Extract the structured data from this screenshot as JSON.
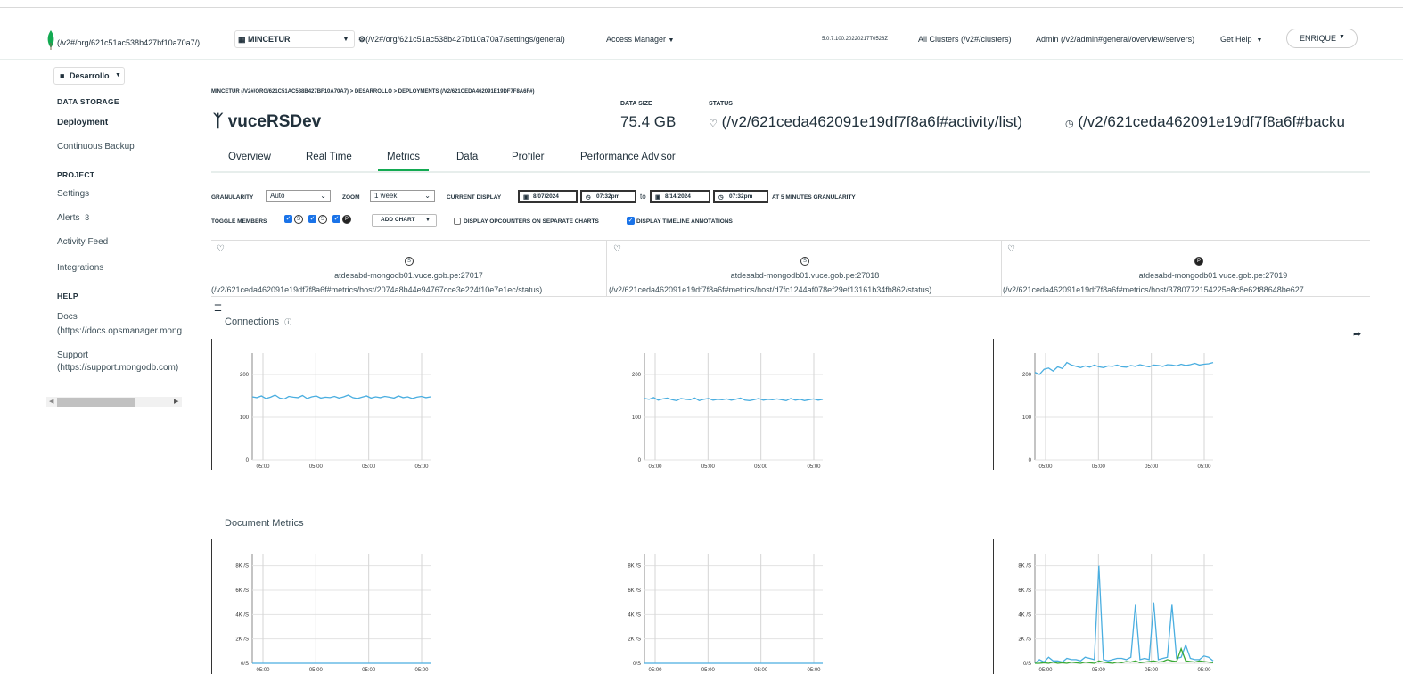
{
  "topbar": {
    "home_link": "(/v2#/org/621c51ac538b427bf10a70a7/)",
    "org_name": "MINCETUR",
    "org_settings_link": "(/v2#/org/621c51ac538b427bf10a70a7/settings/general)",
    "access_manager": "Access Manager",
    "version": "5.0.7.100.20220217T0528Z",
    "all_clusters": "All Clusters (/v2#/clusters)",
    "admin": "Admin (/v2/admin#general/overview/servers)",
    "get_help": "Get Help",
    "user": "ENRIQUE"
  },
  "sidebar": {
    "project_select": "Desarrollo",
    "data_storage_header": "DATA STORAGE",
    "deployment": "Deployment",
    "continuous_backup": "Continuous Backup",
    "project_header": "PROJECT",
    "settings": "Settings",
    "alerts": "Alerts",
    "alerts_count": "3",
    "activity_feed": "Activity Feed",
    "integrations": "Integrations",
    "help_header": "HELP",
    "docs": "Docs",
    "docs_link": "(https://docs.opsmanager.mong",
    "support": "Support",
    "support_link": "(https://support.mongodb.com)"
  },
  "main": {
    "breadcrumb": "MINCETUR (/V2#/ORG/621C51AC538B427BF10A70A7) > DESARROLLO > DEPLOYMENTS (/V2/621CEDA462091E19DF7F8A6F#)",
    "title": "vuceRSDev",
    "data_size_label": "DATA SIZE",
    "data_size_value": "75.4 GB",
    "status_label": "STATUS",
    "status_activity": "(/v2/621ceda462091e19df7f8a6f#activity/list)",
    "status_backup": "(/v2/621ceda462091e19df7f8a6f#backu",
    "tabs": [
      "Overview",
      "Real Time",
      "Metrics",
      "Data",
      "Profiler",
      "Performance Advisor"
    ],
    "active_tab": "Metrics"
  },
  "controls": {
    "granularity_label": "GRANULARITY",
    "granularity_value": "Auto",
    "zoom_label": "ZOOM",
    "zoom_value": "1 week",
    "current_display_label": "CURRENT DISPLAY",
    "start_date": "8/07/2024",
    "start_time": "07:32pm",
    "to_label": "to",
    "end_date": "8/14/2024",
    "end_time": "07:32pm",
    "granularity_note": "AT 5 MINUTES GRANULARITY",
    "toggle_members_label": "TOGGLE MEMBERS",
    "member_badges": [
      "S",
      "S",
      "P"
    ],
    "add_chart": "ADD CHART",
    "opcounters_label": "DISPLAY OPCOUNTERS ON SEPARATE CHARTS",
    "opcounters_checked": false,
    "timeline_label": "DISPLAY TIMELINE ANNOTATIONS",
    "timeline_checked": true
  },
  "hosts": [
    {
      "role": "S",
      "name": "atdesabd-mongodb01.vuce.gob.pe:27017",
      "link": "(/v2/621ceda462091e19df7f8a6f#metrics/host/2074a8b44e94767cce3e224f10e7e1ec/status)"
    },
    {
      "role": "S",
      "name": "atdesabd-mongodb01.vuce.gob.pe:27018",
      "link": "(/v2/621ceda462091e19df7f8a6f#metrics/host/d7fc1244af078ef29ef13161b34fb862/status)"
    },
    {
      "role": "P",
      "name": "atdesabd-mongodb01.vuce.gob.pe:27019",
      "link": "(/v2/621ceda462091e19df7f8a6f#metrics/host/3780772154225e8c8e62f88648be627"
    }
  ],
  "sections": {
    "connections": "Connections",
    "document_metrics": "Document Metrics"
  },
  "colors": {
    "accent_green": "#13aa52",
    "series_blue": "#4aaee0",
    "series_green": "#3aaa35",
    "checkbox_blue": "#1a73e8"
  },
  "chart_data": [
    {
      "type": "line",
      "title": "Connections",
      "host": "atdesabd-mongodb01.vuce.gob.pe:27017",
      "x_ticks": [
        "05:00",
        "05:00",
        "05:00",
        "05:00"
      ],
      "y_ticks": [
        0,
        100,
        200
      ],
      "ylim": [
        0,
        250
      ],
      "series": [
        {
          "values": [
            148,
            146,
            150,
            144,
            147,
            152,
            145,
            143,
            149,
            147,
            146,
            151,
            144,
            148,
            150,
            145,
            147,
            146,
            149,
            145,
            148,
            152,
            146,
            144,
            147,
            150,
            145,
            148,
            146,
            149,
            147,
            145,
            150,
            146,
            148,
            144,
            147,
            149,
            146,
            148
          ]
        }
      ]
    },
    {
      "type": "line",
      "title": "Connections",
      "host": "atdesabd-mongodb01.vuce.gob.pe:27018",
      "x_ticks": [
        "05:00",
        "05:00",
        "05:00",
        "05:00"
      ],
      "y_ticks": [
        0,
        100,
        200
      ],
      "ylim": [
        0,
        250
      ],
      "series": [
        {
          "values": [
            144,
            142,
            146,
            140,
            143,
            145,
            141,
            139,
            144,
            142,
            141,
            145,
            139,
            142,
            144,
            140,
            142,
            141,
            143,
            140,
            142,
            145,
            140,
            139,
            141,
            144,
            140,
            142,
            141,
            143,
            141,
            139,
            144,
            140,
            142,
            139,
            141,
            143,
            140,
            142
          ]
        }
      ]
    },
    {
      "type": "line",
      "title": "Connections",
      "host": "atdesabd-mongodb01.vuce.gob.pe:27019",
      "x_ticks": [
        "05:00",
        "05:00",
        "05:00",
        "05:00"
      ],
      "y_ticks": [
        0,
        100,
        200
      ],
      "ylim": [
        0,
        250
      ],
      "series": [
        {
          "values": [
            205,
            200,
            212,
            215,
            208,
            218,
            214,
            228,
            222,
            219,
            216,
            220,
            217,
            222,
            218,
            216,
            220,
            219,
            222,
            218,
            217,
            221,
            219,
            223,
            220,
            218,
            222,
            221,
            219,
            223,
            222,
            220,
            224,
            221,
            223,
            226,
            222,
            224,
            225,
            228
          ]
        }
      ]
    },
    {
      "type": "line",
      "title": "Document Metrics",
      "host": "atdesabd-mongodb01.vuce.gob.pe:27017",
      "x_ticks": [
        "05:00",
        "05:00",
        "05:00",
        "05:00"
      ],
      "y_ticks": [
        "0/S",
        "2K /S",
        "4K /S",
        "6K /S",
        "8K /S"
      ],
      "ylim": [
        0,
        9000
      ],
      "series": [
        {
          "values": [
            0,
            0,
            0,
            0,
            0,
            0,
            0,
            0,
            0,
            0,
            0,
            0,
            0,
            0,
            0,
            0,
            0,
            0,
            0,
            0
          ]
        }
      ]
    },
    {
      "type": "line",
      "title": "Document Metrics",
      "host": "atdesabd-mongodb01.vuce.gob.pe:27018",
      "x_ticks": [
        "05:00",
        "05:00",
        "05:00",
        "05:00"
      ],
      "y_ticks": [
        "0/S",
        "2K /S",
        "4K /S",
        "6K /S",
        "8K /S"
      ],
      "ylim": [
        0,
        9000
      ],
      "series": [
        {
          "values": [
            0,
            0,
            0,
            0,
            0,
            0,
            0,
            0,
            0,
            0,
            0,
            0,
            0,
            0,
            0,
            0,
            0,
            0,
            0,
            0
          ]
        }
      ]
    },
    {
      "type": "line",
      "title": "Document Metrics",
      "host": "atdesabd-mongodb01.vuce.gob.pe:27019",
      "x_ticks": [
        "05:00",
        "05:00",
        "05:00",
        "05:00"
      ],
      "y_ticks": [
        "0/S",
        "2K /S",
        "4K /S",
        "6K /S",
        "8K /S"
      ],
      "ylim": [
        0,
        9000
      ],
      "series": [
        {
          "values": [
            0,
            300,
            100,
            500,
            200,
            200,
            100,
            400,
            300,
            300,
            200,
            500,
            400,
            300,
            8000,
            300,
            200,
            300,
            400,
            400,
            300,
            500,
            4800,
            300,
            400,
            300,
            5000,
            300,
            400,
            500,
            4800,
            400,
            500,
            1500,
            400,
            300,
            300,
            600,
            500,
            200
          ]
        },
        {
          "values": [
            0,
            0,
            50,
            0,
            100,
            0,
            50,
            0,
            100,
            50,
            0,
            100,
            50,
            0,
            200,
            100,
            50,
            0,
            100,
            50,
            150,
            100,
            200,
            50,
            100,
            150,
            200,
            100,
            150,
            300,
            200,
            150,
            1200,
            200,
            150,
            100,
            200,
            150,
            100,
            50
          ]
        }
      ]
    }
  ]
}
